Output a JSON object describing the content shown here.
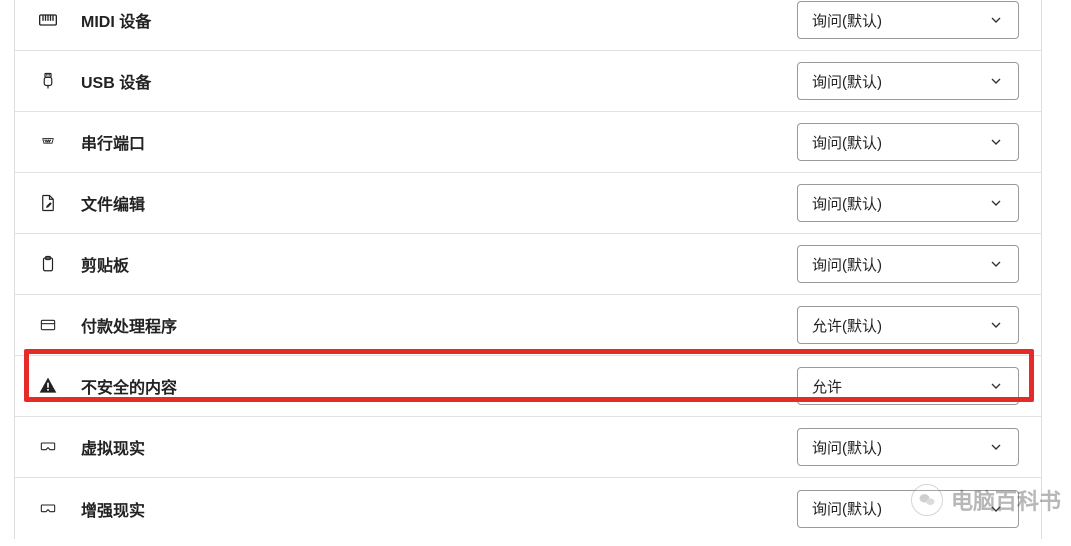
{
  "rows": [
    {
      "icon": "midi-icon",
      "label": "MIDI 设备",
      "value": "询问(默认)"
    },
    {
      "icon": "usb-icon",
      "label": "USB 设备",
      "value": "询问(默认)"
    },
    {
      "icon": "serial-icon",
      "label": "串行端口",
      "value": "询问(默认)"
    },
    {
      "icon": "file-edit-icon",
      "label": "文件编辑",
      "value": "询问(默认)"
    },
    {
      "icon": "clipboard-icon",
      "label": "剪贴板",
      "value": "询问(默认)"
    },
    {
      "icon": "payment-icon",
      "label": "付款处理程序",
      "value": "允许(默认)"
    },
    {
      "icon": "warning-icon",
      "label": "不安全的内容",
      "value": "允许"
    },
    {
      "icon": "vr-icon",
      "label": "虚拟现实",
      "value": "询问(默认)"
    },
    {
      "icon": "ar-icon",
      "label": "增强现实",
      "value": "询问(默认)"
    }
  ],
  "highlight_index": 6,
  "watermark": {
    "text": "电脑百科书"
  }
}
